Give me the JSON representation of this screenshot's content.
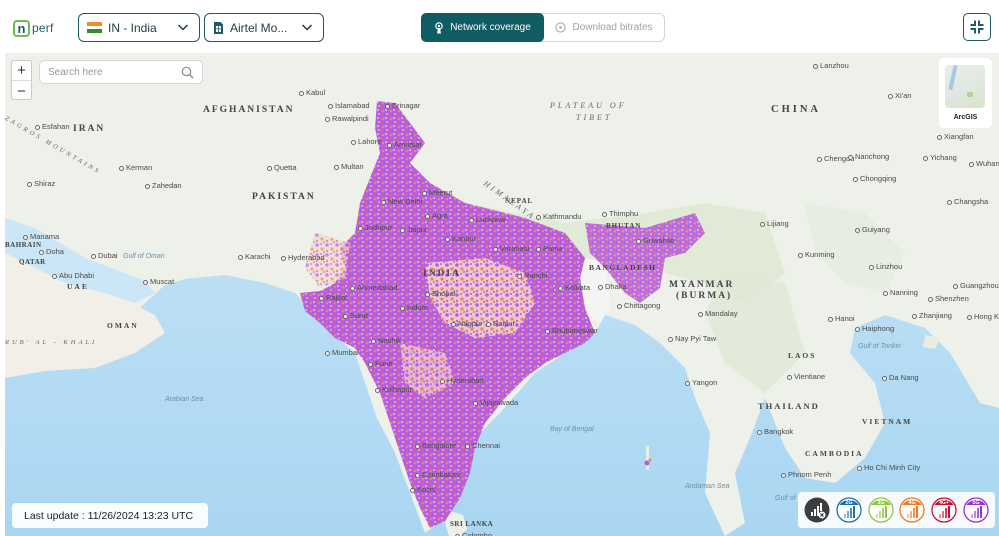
{
  "app": {
    "logo_text": "perf",
    "logo_letter": "n"
  },
  "header": {
    "country_select": {
      "value": "IN - India",
      "flag": "india-flag"
    },
    "operator_select": {
      "value": "Airtel Mo...",
      "icon": "sim-card-icon"
    },
    "view_toggle": {
      "active": "Network coverage",
      "options": [
        {
          "label": "Network coverage",
          "icon": "antenna-icon",
          "active": true
        },
        {
          "label": "Download bitrates",
          "icon": "download-circle-icon",
          "active": false
        }
      ]
    },
    "fullscreen_icon": "exit-fullscreen-icon"
  },
  "map": {
    "zoom_in": "+",
    "zoom_out": "−",
    "search": {
      "placeholder": "Search here",
      "value": ""
    },
    "basemap_label": "ArcGIS",
    "last_update": "Last update : 11/26/2024 13:23 UTC",
    "coverage_colors": {
      "5g": "#a652e8",
      "4g_plus": "#d04a6a",
      "4g": "#f08a3c"
    },
    "labels": {
      "countries": [
        "AFGHANISTAN",
        "IRAN",
        "PAKISTAN",
        "INDIA",
        "NEPAL",
        "BHUTAN",
        "BANGLADESH",
        "MYANMAR",
        "(BURMA)",
        "CHINA",
        "LAOS",
        "THAILAND",
        "VIETNAM",
        "CAMBODIA",
        "SRI LANKA",
        "OMAN",
        "UAE",
        "QATAR",
        "BAHRAIN"
      ],
      "regions": [
        "PLATEAU OF",
        "TIBET",
        "HIMALAYA",
        "ZAGROS MOUNTAINS",
        "RUB' AL - KHALI"
      ],
      "water": [
        "Gulf of Oman",
        "Arabian Sea",
        "Bay of Bengal",
        "Andaman Sea",
        "Gulf of Tonkin",
        "Gulf of Thailand"
      ],
      "cities": [
        "Esfahan",
        "Shiraz",
        "Kerman",
        "Zahedan",
        "Manama",
        "Doha",
        "Dubai",
        "Abu Dhabi",
        "Muscat",
        "Kabul",
        "Islamabad",
        "Rawalpindi",
        "Srinagar",
        "Lahore",
        "Amritsar",
        "Quetta",
        "Multan",
        "Karachi",
        "Hyderabad",
        "Meerut",
        "New Delhi",
        "Agra",
        "Jaipur",
        "Jodhpur",
        "Lucknow",
        "Kanpur",
        "Varanasi",
        "Patna",
        "Kathmandu",
        "Thimphu",
        "Guwahati",
        "Dhaka",
        "Chittagong",
        "Ranchi",
        "Kolkata",
        "Ahmedabad",
        "Rajkot",
        "Surat",
        "Bhopal",
        "Indore",
        "Nagpur",
        "Raipur",
        "Bhubaneswar",
        "Nashik",
        "Mumbai",
        "Pune",
        "Hyderabad",
        "Kolhapur",
        "Vijayawada",
        "Bangalore",
        "Chennai",
        "Coimbatore",
        "Kochi",
        "Colombo",
        "Mandalay",
        "Nay Pyi Taw",
        "Yangon",
        "Bangkok",
        "Phnom Penh",
        "Ho Chi Minh City",
        "Vientiane",
        "Hanoi",
        "Haiphong",
        "Da Nang",
        "Lanzhou",
        "Xi'an",
        "Chengdu",
        "Nanchong",
        "Chongqing",
        "Xiangfan",
        "Yichang",
        "Wuhan",
        "Changsha",
        "Lijiang",
        "Guiyang",
        "Kunming",
        "Linzhou",
        "Nanning",
        "Guangzhou",
        "Shenzhen",
        "Zhanjiang",
        "Hong Kong"
      ]
    }
  },
  "legend": {
    "items": [
      {
        "label": "",
        "name": "no-coverage",
        "color": "#3d3d3d"
      },
      {
        "label": "2G",
        "name": "2g",
        "color": "#1e6fb4"
      },
      {
        "label": "3G",
        "name": "3g",
        "color": "#8cc63f"
      },
      {
        "label": "4G",
        "name": "4g",
        "color": "#f07a22"
      },
      {
        "label": "4G+",
        "name": "4g-plus",
        "color": "#c8102e"
      },
      {
        "label": "5G",
        "name": "5g",
        "color": "#9b30d9"
      }
    ]
  }
}
